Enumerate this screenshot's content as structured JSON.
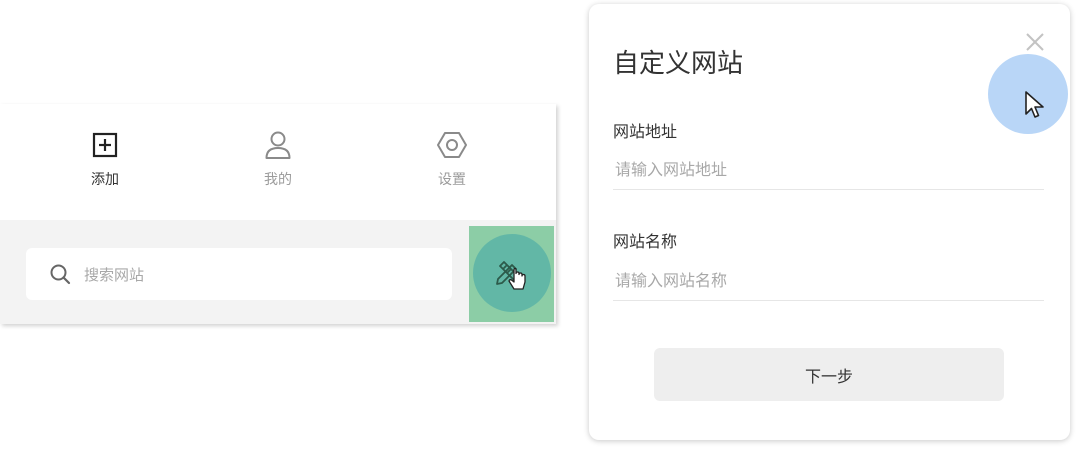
{
  "toolbar": {
    "items": [
      {
        "label": "添加",
        "icon": "plus-square-icon"
      },
      {
        "label": "我的",
        "icon": "user-icon"
      },
      {
        "label": "设置",
        "icon": "hexagon-gear-icon"
      }
    ]
  },
  "search": {
    "placeholder": "搜索网站",
    "edit_icon": "pencil-ruler-icon"
  },
  "dialog": {
    "title": "自定义网站",
    "url_label": "网站地址",
    "url_placeholder": "请输入网站地址",
    "name_label": "网站名称",
    "name_placeholder": "请输入网站名称",
    "next_button": "下一步"
  },
  "colors": {
    "edit_button_bg": "#8ccda6",
    "click_indicator": "#b5d4f7",
    "search_area_bg": "#f3f3f3"
  }
}
